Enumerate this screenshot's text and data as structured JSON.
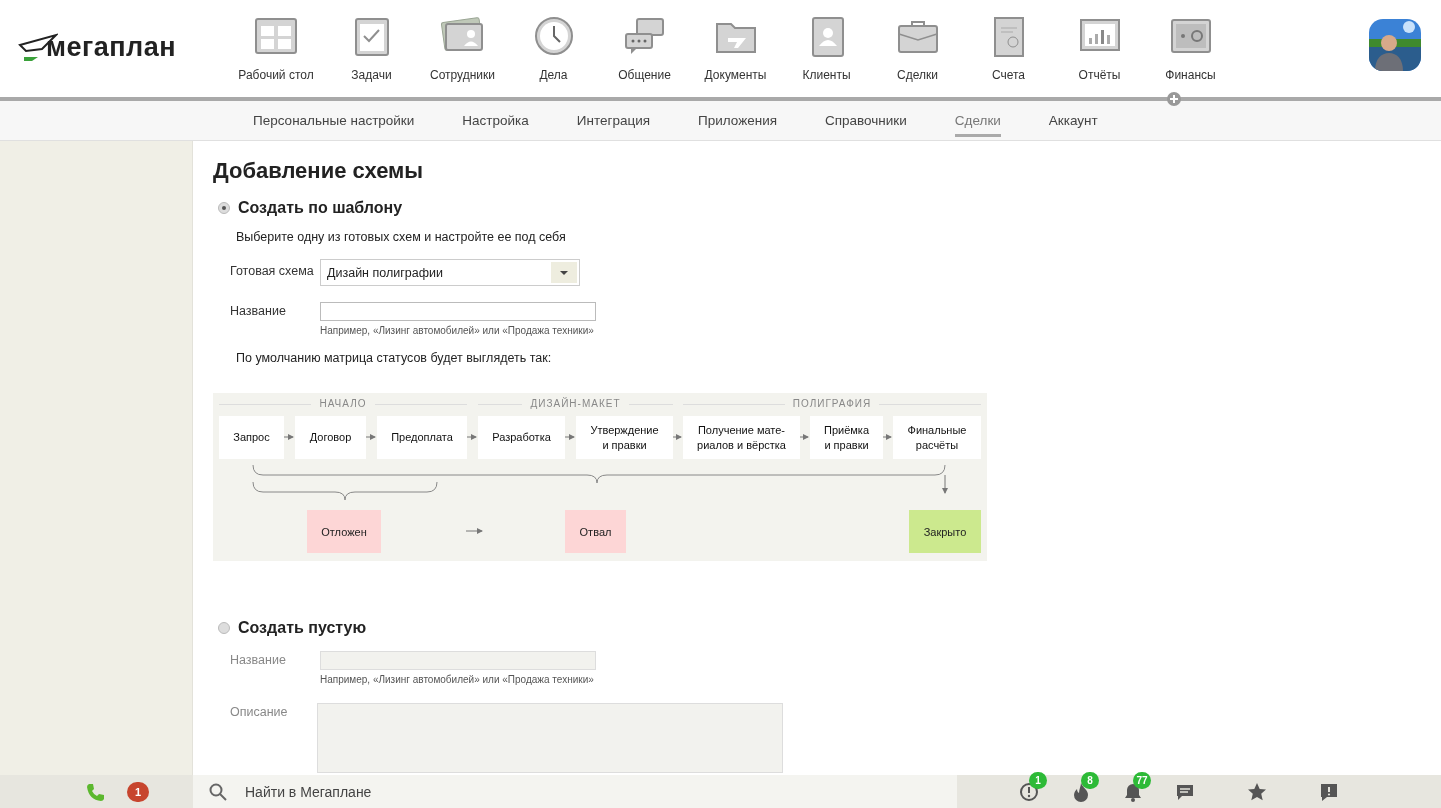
{
  "header": {
    "logo": "мегаплан",
    "nav": [
      {
        "label": "Рабочий стол"
      },
      {
        "label": "Задачи"
      },
      {
        "label": "Сотрудники"
      },
      {
        "label": "Дела"
      },
      {
        "label": "Общение"
      },
      {
        "label": "Документы"
      },
      {
        "label": "Клиенты"
      },
      {
        "label": "Сделки"
      },
      {
        "label": "Счета"
      },
      {
        "label": "Отчёты"
      },
      {
        "label": "Финансы"
      }
    ]
  },
  "subnav": [
    {
      "label": "Персональные настройки",
      "selected": false
    },
    {
      "label": "Настройка",
      "selected": false
    },
    {
      "label": "Интеграция",
      "selected": false
    },
    {
      "label": "Приложения",
      "selected": false
    },
    {
      "label": "Справочники",
      "selected": false
    },
    {
      "label": "Сделки",
      "selected": true
    },
    {
      "label": "Аккаунт",
      "selected": false
    }
  ],
  "title": "Добавление схемы",
  "template_option": {
    "label": "Создать по шаблону",
    "selected": true,
    "hint": "Выберите одну из готовых схем и настройте ее под себя",
    "scheme": {
      "label": "Готовая схема",
      "value": "Дизайн полиграфии"
    },
    "name": {
      "label": "Название",
      "note": "Например, «Лизинг автомобилей» или «Продажа техники»"
    },
    "matrix_caption": "По умолчанию матрица статусов будет выглядеть так:",
    "diagram": {
      "groups": [
        {
          "label": "НАЧАЛО",
          "stages": [
            "Запрос",
            "Договор",
            "Предоплата"
          ]
        },
        {
          "label": "ДИЗАЙН-МАКЕТ",
          "stages": [
            "Разработка",
            "Утверждение\nи правки"
          ]
        },
        {
          "label": "ПОЛИГРАФИЯ",
          "stages": [
            "Получение мате-\nриалов и вёрстка",
            "Приёмка\nи правки",
            "Финальные\nрасчёты"
          ]
        }
      ],
      "outcomes": [
        {
          "label": "Отложен",
          "kind": "negative"
        },
        {
          "label": "Отвал",
          "kind": "negative"
        },
        {
          "label": "Закрыто",
          "kind": "positive"
        }
      ]
    }
  },
  "empty_option": {
    "label": "Создать пустую",
    "selected": false,
    "name": {
      "label": "Название",
      "note": "Например, «Лизинг автомобилей» или «Продажа техники»",
      "disabled": true
    },
    "description": {
      "label": "Описание",
      "disabled": true
    }
  },
  "bottom_bar": {
    "missed_calls": "1",
    "search_placeholder": "Найти в Мегаплане",
    "notifications": [
      {
        "badge": "1"
      },
      {
        "badge": "8"
      },
      {
        "badge": "77"
      }
    ]
  }
}
